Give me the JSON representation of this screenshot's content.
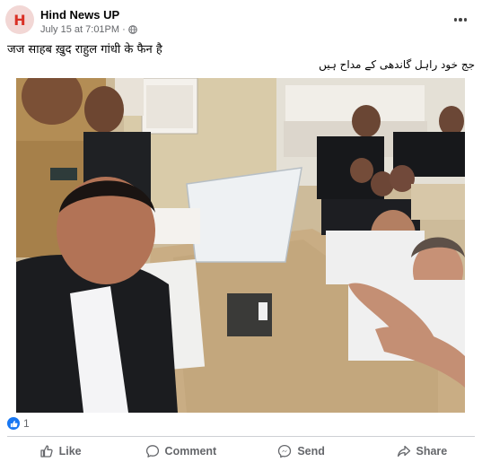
{
  "post": {
    "avatar_letter": "H",
    "page_name": "Hind News UP",
    "timestamp": "July 15 at 7:01PM",
    "separator": "·",
    "audience_icon": "globe-icon",
    "more_icon": "more-options-icon",
    "caption_hindi": "जज साहब ख़ुद राहुल गांधी के फैन है",
    "caption_urdu": "جج خود راہل گاندھی کے مداح ہیں"
  },
  "reactions": {
    "icon": "like-reaction-icon",
    "count": "1"
  },
  "actions": [
    {
      "label": "Like",
      "icon": "thumbs-up-icon"
    },
    {
      "label": "Comment",
      "icon": "comment-bubble-icon"
    },
    {
      "label": "Send",
      "icon": "messenger-icon"
    },
    {
      "label": "Share",
      "icon": "share-arrow-icon"
    }
  ],
  "colors": {
    "accent": "#1877f2",
    "secondary_text": "#65676b",
    "avatar_bg": "#f2d7d5",
    "avatar_letter": "#d93025"
  }
}
